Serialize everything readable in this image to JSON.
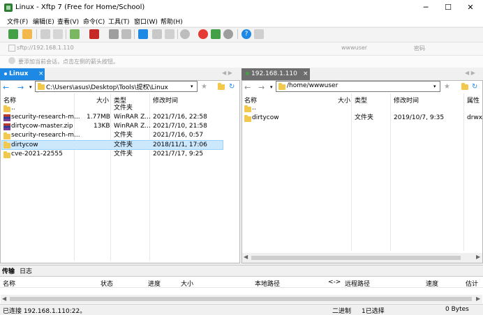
{
  "window": {
    "title": "Linux - Xftp 7 (Free for Home/School)",
    "minimize": "─",
    "maximize": "☐",
    "close": "✕"
  },
  "menu": [
    "文件(F)",
    "编辑(E)",
    "查看(V)",
    "命令(C)",
    "工具(T)",
    "窗口(W)",
    "帮助(H)"
  ],
  "address": {
    "placeholder": "sftp://192.168.1.110",
    "user_placeholder": "wwwuser",
    "password_placeholder": "密码"
  },
  "hint": "要添加当前会话，点击左侧的箭头按钮。",
  "left_tab": {
    "label": "Linux",
    "close": "×"
  },
  "right_tab": {
    "label": "192.168.1.110",
    "close": "×"
  },
  "left_panel": {
    "path": "C:\\Users\\asus\\Desktop\\Tools\\提权\\Linux",
    "columns": [
      "名称",
      "大小",
      "类型",
      "修改时间"
    ],
    "rows": [
      {
        "name": "..",
        "size": "",
        "type": "文件夹",
        "time": "",
        "icon": "folder"
      },
      {
        "name": "security-research-m...",
        "size": "1.77MB",
        "type": "WinRAR Z...",
        "time": "2021/7/16, 22:58",
        "icon": "zip"
      },
      {
        "name": "dirtycow-master.zip",
        "size": "13KB",
        "type": "WinRAR Z...",
        "time": "2021/7/10, 21:58",
        "icon": "zip"
      },
      {
        "name": "security-research-m...",
        "size": "",
        "type": "文件夹",
        "time": "2021/7/16, 0:57",
        "icon": "folder"
      },
      {
        "name": "dirtycow",
        "size": "",
        "type": "文件夹",
        "time": "2018/11/1, 17:06",
        "icon": "folder",
        "selected": true
      },
      {
        "name": "cve-2021-22555",
        "size": "",
        "type": "文件夹",
        "time": "2021/7/17, 9:25",
        "icon": "folder"
      }
    ]
  },
  "right_panel": {
    "path": "/home/wwwuser",
    "columns": [
      "名称",
      "大小",
      "类型",
      "修改时间",
      "属性"
    ],
    "rows": [
      {
        "name": "..",
        "size": "",
        "type": "",
        "time": "",
        "attr": "",
        "icon": "folder"
      },
      {
        "name": "dirtycow",
        "size": "",
        "type": "文件夹",
        "time": "2019/10/7, 9:35",
        "attr": "drwx",
        "icon": "folder"
      }
    ]
  },
  "bottom_tabs": [
    "传输",
    "日志"
  ],
  "transfer_columns": [
    "名称",
    "状态",
    "进度",
    "大小",
    "本地路径",
    "<->",
    "远程路径",
    "速度",
    "估计"
  ],
  "status": {
    "connection": "已连接 192.168.1.110:22。",
    "mode": "二进制",
    "selection": "1已选择",
    "bytes": "0 Bytes"
  }
}
